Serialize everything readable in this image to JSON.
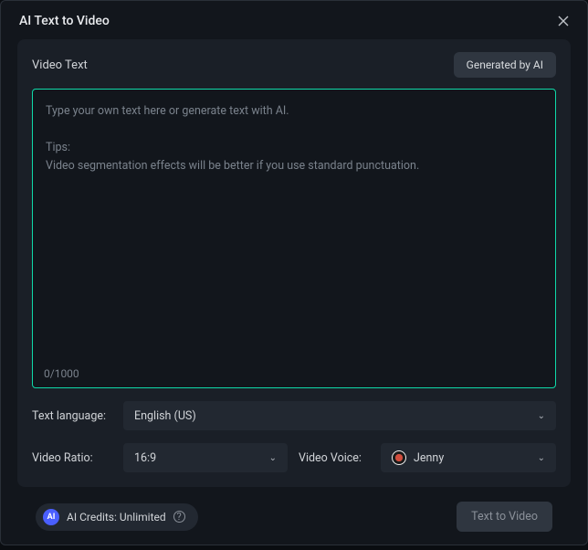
{
  "window": {
    "title": "AI Text to Video"
  },
  "panel": {
    "label": "Video Text",
    "generate_button": "Generated by AI",
    "textarea_placeholder": "Type your own text here or generate text with AI.\n\nTips:\nVideo segmentation effects will be better if you use standard punctuation.",
    "textarea_value": "",
    "counter": "0/1000"
  },
  "fields": {
    "language_label": "Text language:",
    "language_value": "English (US)",
    "ratio_label": "Video Ratio:",
    "ratio_value": "16:9",
    "voice_label": "Video Voice:",
    "voice_value": "Jenny"
  },
  "footer": {
    "ai_chip": "AI",
    "credits_text": "AI Credits: Unlimited",
    "help": "?",
    "primary_button": "Text to Video"
  }
}
